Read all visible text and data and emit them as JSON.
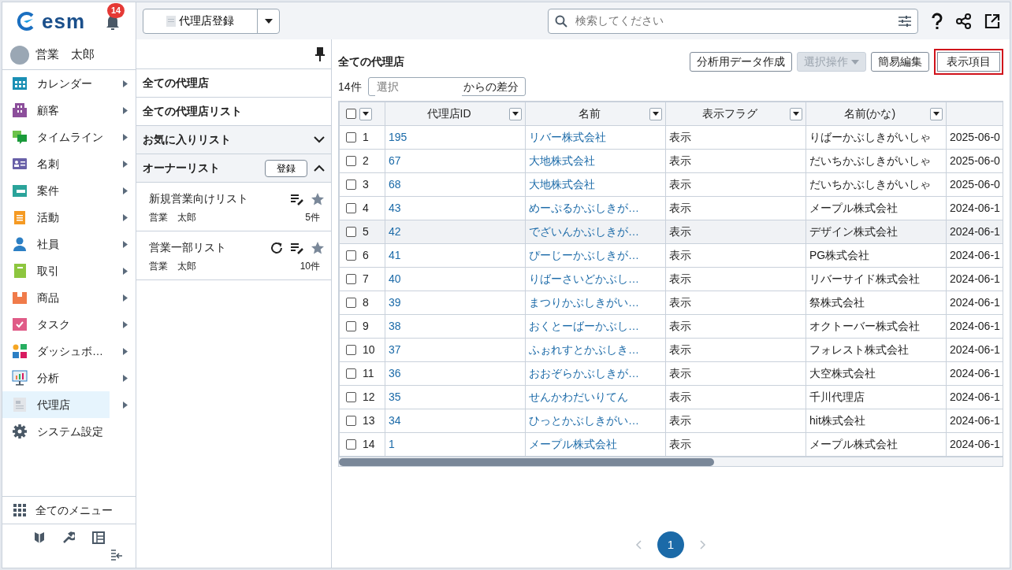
{
  "sidebar": {
    "logo": "esm",
    "notifications": "14",
    "user": "営業　太郎",
    "items": [
      {
        "label": "カレンダー",
        "selected": false,
        "has_submenu": true
      },
      {
        "label": "顧客",
        "selected": false,
        "has_submenu": true
      },
      {
        "label": "タイムライン",
        "selected": false,
        "has_submenu": true
      },
      {
        "label": "名刺",
        "selected": false,
        "has_submenu": true
      },
      {
        "label": "案件",
        "selected": false,
        "has_submenu": true
      },
      {
        "label": "活動",
        "selected": false,
        "has_submenu": true
      },
      {
        "label": "社員",
        "selected": false,
        "has_submenu": true
      },
      {
        "label": "取引",
        "selected": false,
        "has_submenu": true
      },
      {
        "label": "商品",
        "selected": false,
        "has_submenu": true
      },
      {
        "label": "タスク",
        "selected": false,
        "has_submenu": true
      },
      {
        "label": "ダッシュボ…",
        "selected": false,
        "has_submenu": true
      },
      {
        "label": "分析",
        "selected": false,
        "has_submenu": true
      },
      {
        "label": "代理店",
        "selected": true,
        "has_submenu": true
      },
      {
        "label": "システム設定",
        "selected": false,
        "has_submenu": false
      }
    ],
    "all_menu": "全てのメニュー"
  },
  "toolbar": {
    "register_button": "代理店登録",
    "search": {
      "placeholder": "検索してください"
    }
  },
  "list_panel": {
    "sections": [
      {
        "kind": "link",
        "label": "全ての代理店"
      },
      {
        "kind": "link",
        "label": "全ての代理店リスト"
      },
      {
        "kind": "group",
        "label": "お気に入りリスト",
        "expanded": false
      },
      {
        "kind": "group",
        "label": "オーナーリスト",
        "expanded": true,
        "button": "登録",
        "lists": [
          {
            "name": "新規営業向けリスト",
            "owner": "営業　太郎",
            "count": "5件",
            "refreshable": false
          },
          {
            "name": "営業一部リスト",
            "owner": "営業　太郎",
            "count": "10件",
            "refreshable": true
          }
        ]
      }
    ]
  },
  "main": {
    "title": "全ての代理店",
    "actions": [
      {
        "label": "分析用データ作成",
        "disabled": false,
        "dropdown": false,
        "highlighted": false
      },
      {
        "label": "選択操作",
        "disabled": true,
        "dropdown": true,
        "highlighted": false
      },
      {
        "label": "簡易編集",
        "disabled": false,
        "dropdown": false,
        "highlighted": false
      },
      {
        "label": "表示項目",
        "disabled": false,
        "dropdown": false,
        "highlighted": true
      }
    ],
    "count": "14件",
    "diff": {
      "placeholder": "選択",
      "suffix": "からの差分"
    },
    "table": {
      "select_all_checked": false,
      "columns": [
        "代理店ID",
        "名前",
        "表示フラグ",
        "名前(かな)"
      ],
      "rows": [
        {
          "no": "1",
          "id": "195",
          "name": "リバー株式会社",
          "flag": "表示",
          "kana": "りばーかぶしきがいしゃ",
          "date": "2025-06-0",
          "checked": false,
          "highlighted": false
        },
        {
          "no": "2",
          "id": "67",
          "name": "大地株式会社",
          "flag": "表示",
          "kana": "だいちかぶしきがいしゃ",
          "date": "2025-06-0",
          "checked": false,
          "highlighted": false
        },
        {
          "no": "3",
          "id": "68",
          "name": "大地株式会社",
          "flag": "表示",
          "kana": "だいちかぶしきがいしゃ",
          "date": "2025-06-0",
          "checked": false,
          "highlighted": false
        },
        {
          "no": "4",
          "id": "43",
          "name": "めーぷるかぶしきが…",
          "flag": "表示",
          "kana": "メープル株式会社",
          "date": "2024-06-1",
          "checked": false,
          "highlighted": false
        },
        {
          "no": "5",
          "id": "42",
          "name": "でざいんかぶしきが…",
          "flag": "表示",
          "kana": "デザイン株式会社",
          "date": "2024-06-1",
          "checked": false,
          "highlighted": true
        },
        {
          "no": "6",
          "id": "41",
          "name": "ぴーじーかぶしきが…",
          "flag": "表示",
          "kana": "PG株式会社",
          "date": "2024-06-1",
          "checked": false,
          "highlighted": false
        },
        {
          "no": "7",
          "id": "40",
          "name": "りばーさいどかぶし…",
          "flag": "表示",
          "kana": "リバーサイド株式会社",
          "date": "2024-06-1",
          "checked": false,
          "highlighted": false
        },
        {
          "no": "8",
          "id": "39",
          "name": "まつりかぶしきがい…",
          "flag": "表示",
          "kana": "祭株式会社",
          "date": "2024-06-1",
          "checked": false,
          "highlighted": false
        },
        {
          "no": "9",
          "id": "38",
          "name": "おくとーばーかぶし…",
          "flag": "表示",
          "kana": "オクトーバー株式会社",
          "date": "2024-06-1",
          "checked": false,
          "highlighted": false
        },
        {
          "no": "10",
          "id": "37",
          "name": "ふぉれすとかぶしき…",
          "flag": "表示",
          "kana": "フォレスト株式会社",
          "date": "2024-06-1",
          "checked": false,
          "highlighted": false
        },
        {
          "no": "11",
          "id": "36",
          "name": "おおぞらかぶしきが…",
          "flag": "表示",
          "kana": "大空株式会社",
          "date": "2024-06-1",
          "checked": false,
          "highlighted": false
        },
        {
          "no": "12",
          "id": "35",
          "name": "せんかわだいりてん",
          "flag": "表示",
          "kana": "千川代理店",
          "date": "2024-06-1",
          "checked": false,
          "highlighted": false
        },
        {
          "no": "13",
          "id": "34",
          "name": "ひっとかぶしきがい…",
          "flag": "表示",
          "kana": "hit株式会社",
          "date": "2024-06-1",
          "checked": false,
          "highlighted": false
        },
        {
          "no": "14",
          "id": "1",
          "name": "メープル株式会社",
          "flag": "表示",
          "kana": "メープル株式会社",
          "date": "2024-06-1",
          "checked": false,
          "highlighted": false
        }
      ]
    },
    "pagination": [
      {
        "label": "1",
        "selected": true
      }
    ]
  }
}
